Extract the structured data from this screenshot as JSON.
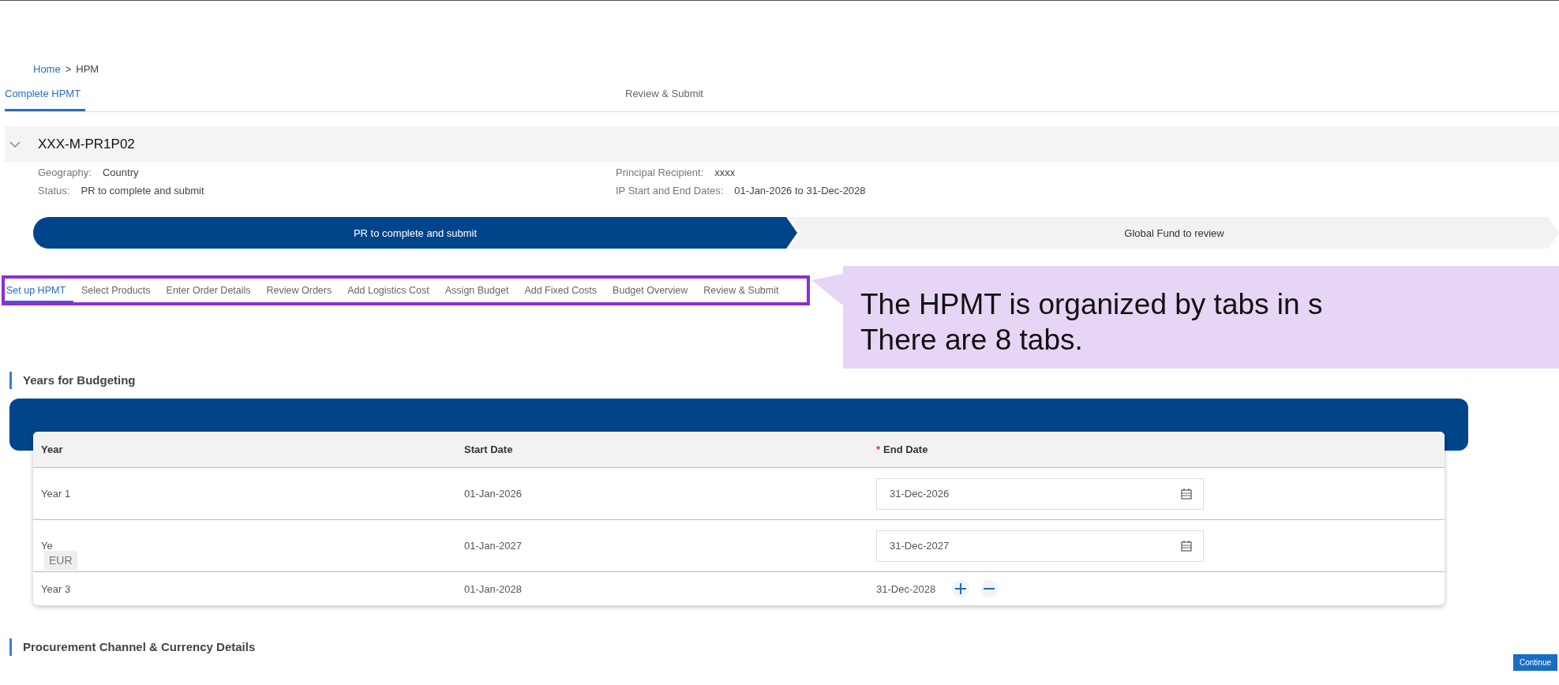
{
  "breadcrumb": [
    {
      "label": "Home",
      "kind": "link"
    },
    {
      "label": ">",
      "kind": "separator"
    },
    {
      "label": "HPM",
      "kind": "current"
    }
  ],
  "top_tabs": [
    {
      "label": "Complete HPMT",
      "selected": true
    },
    {
      "label": "Review & Submit",
      "selected": false
    }
  ],
  "record": {
    "title": "XXX-M-PR1P02",
    "expanded": true,
    "fields_left": [
      {
        "label": "Geography:",
        "value": "Country"
      },
      {
        "label": "Status:",
        "value": "PR to complete and submit"
      }
    ],
    "fields_right": [
      {
        "label": "Principal Recipient:",
        "value": "xxxx"
      },
      {
        "label": "IP Start and End Dates:",
        "value": "01-Jan-2026 to 31-Dec-2028"
      }
    ]
  },
  "stepper": [
    {
      "label": "PR to complete and submit",
      "selected": true
    },
    {
      "label": "Global Fund to review",
      "selected": false
    }
  ],
  "step_tabs": [
    {
      "label": "Set up HPMT",
      "selected": true
    },
    {
      "label": "Select Products",
      "selected": false
    },
    {
      "label": "Enter Order Details",
      "selected": false
    },
    {
      "label": "Review Orders",
      "selected": false
    },
    {
      "label": "Add Logistics Cost",
      "selected": false
    },
    {
      "label": "Assign Budget",
      "selected": false
    },
    {
      "label": "Add Fixed Costs",
      "selected": false
    },
    {
      "label": "Budget Overview",
      "selected": false
    },
    {
      "label": "Review & Submit",
      "selected": false
    }
  ],
  "callout": {
    "lines": [
      "The HPMT is organized by tabs in s",
      "There are 8 tabs."
    ]
  },
  "years": {
    "title": "Years for Budgeting",
    "columns": [
      {
        "label": "Year"
      },
      {
        "label": "Start Date"
      },
      {
        "label": "End Date",
        "required_mark": "*"
      }
    ],
    "rows": [
      {
        "year": "Year 1",
        "start": "01-Jan-2026",
        "end": "31-Dec-2026",
        "kind": "picker"
      },
      {
        "year": "Ye",
        "start": "01-Jan-2027",
        "end": "31-Dec-2027",
        "kind": "picker"
      },
      {
        "year": "Year 3",
        "start": "01-Jan-2028",
        "end": "31-Dec-2028",
        "kind": "text"
      }
    ]
  },
  "tooltip": {
    "text": "EUR"
  },
  "procurement": {
    "title": "Procurement Channel & Currency Details"
  },
  "continue_button": "Continue"
}
